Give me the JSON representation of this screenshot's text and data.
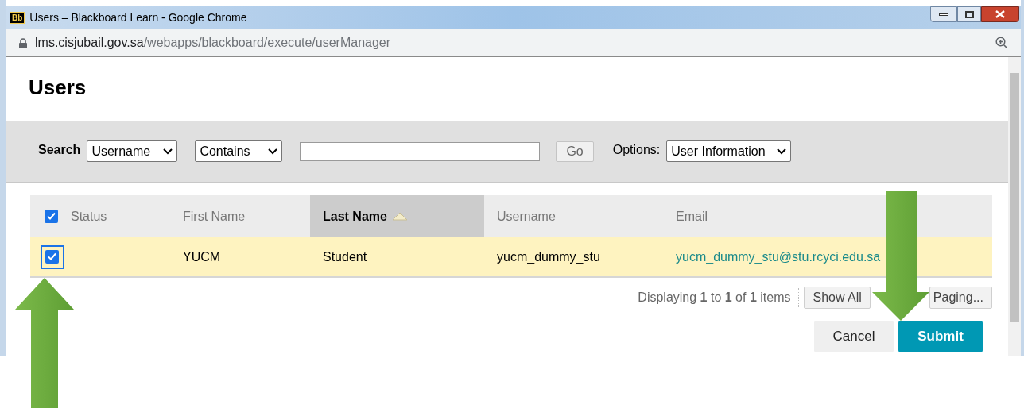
{
  "window": {
    "title": "Users – Blackboard Learn - Google Chrome",
    "app_badge": "Bb"
  },
  "address": {
    "host": "lms.cisjubail.gov.sa",
    "path": "/webapps/blackboard/execute/userManager"
  },
  "page_title": "Users",
  "search": {
    "label": "Search",
    "field_select": "Username",
    "operator_select": "Contains",
    "go_button": "Go",
    "options_label": "Options:",
    "options_select": "User Information"
  },
  "table": {
    "select_all_checked": true,
    "columns": [
      {
        "label": "Status",
        "sorted": false
      },
      {
        "label": "First Name",
        "sorted": false
      },
      {
        "label": "Last Name",
        "sorted": true
      },
      {
        "label": "Username",
        "sorted": false
      },
      {
        "label": "Email",
        "sorted": false
      }
    ],
    "rows": [
      {
        "checked": true,
        "first_name": "YUCM",
        "last_name": "Student",
        "username": "yucm_dummy_stu",
        "email": "yucm_dummy_stu@stu.rcyci.edu.sa"
      }
    ]
  },
  "pagination": {
    "summary": "Displaying **1** to **1** of **1** items",
    "show_all_button": "Show All",
    "paging_button": "Paging..."
  },
  "actions": {
    "cancel_button": "Cancel",
    "submit_button": "Submit"
  }
}
